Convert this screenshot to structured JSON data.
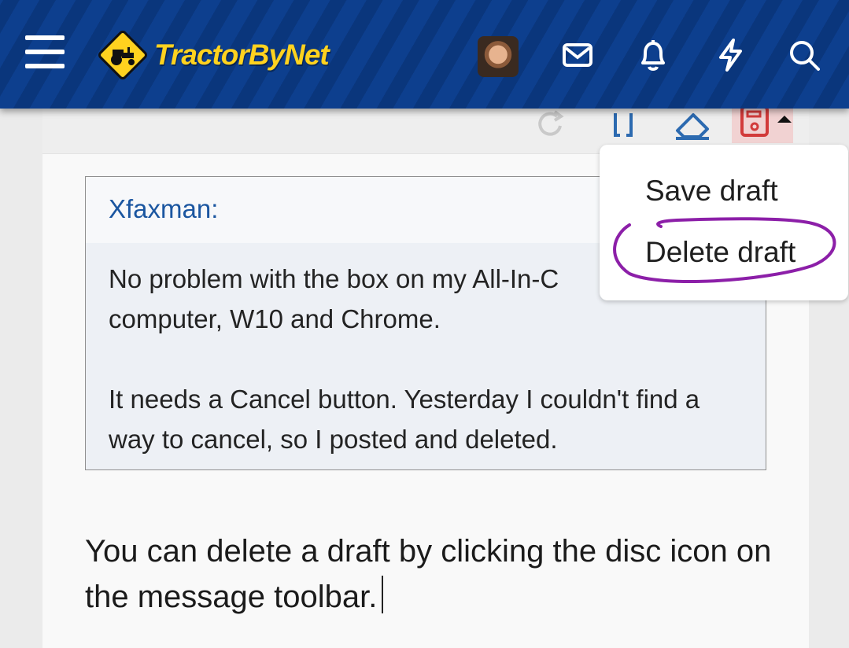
{
  "header": {
    "logo_text": "TractorByNet",
    "icons": [
      "menu-icon",
      "tractor-logo-icon",
      "avatar",
      "envelope-icon",
      "bell-icon",
      "lightning-icon",
      "search-icon"
    ]
  },
  "toolbar": {
    "icons": [
      "redo-icon",
      "brackets-icon",
      "eraser-icon",
      "save-draft-icon",
      "caret-up-icon"
    ]
  },
  "menu": {
    "save_draft": "Save draft",
    "delete_draft": "Delete draft"
  },
  "quote": {
    "author": "Xfaxman:",
    "line1": "No problem with the box on my All-In-C",
    "line2": "computer, W10 and Chrome.",
    "para2": "It needs a Cancel button. Yesterday I couldn't find a way to cancel, so I posted and deleted."
  },
  "reply": {
    "text": "You can delete a draft by clicking the disc icon on the message toolbar."
  },
  "colors": {
    "header_bg": "#0d3f8e",
    "logo_yellow": "#ffd21f",
    "quote_author": "#1b56a0",
    "annotation": "#8c1fa8",
    "save_icon": "#d23a3a"
  }
}
